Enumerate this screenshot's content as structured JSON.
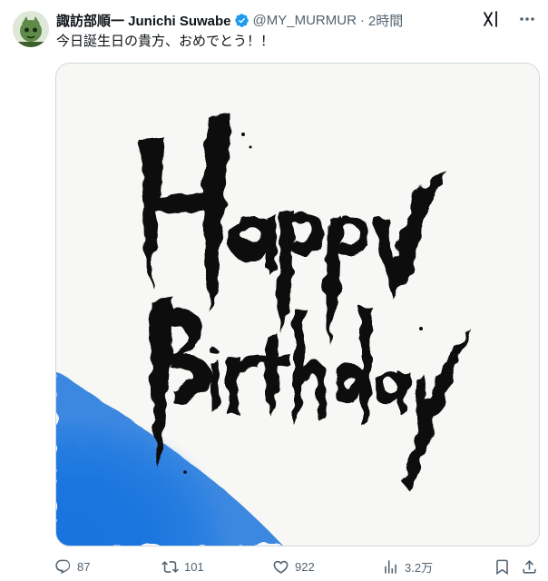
{
  "author": {
    "display_name": "諏訪部順一 Junichi Suwabe",
    "handle": "@MY_MURMUR",
    "separator": "·",
    "time": "2時間",
    "verified": true
  },
  "tweet": {
    "text": "今日誕生日の貴方、おめでとう！！"
  },
  "media": {
    "calligraphy_line1": "Happy",
    "calligraphy_line2": "Birthday",
    "ink_color": "#0a0a0a",
    "wash_color": "#1e7be0",
    "paper_color": "#f7f7f5"
  },
  "actions": {
    "replies": "87",
    "retweets": "101",
    "likes": "922",
    "views": "3.2万"
  },
  "colors": {
    "text": "#0f1419",
    "secondary": "#536471",
    "verified": "#1d9bf0",
    "border": "#cfd9de"
  },
  "icons": [
    "verified-badge-icon",
    "grok-icon",
    "more-icon",
    "reply-icon",
    "retweet-icon",
    "like-icon",
    "views-icon",
    "bookmark-icon",
    "share-icon"
  ]
}
